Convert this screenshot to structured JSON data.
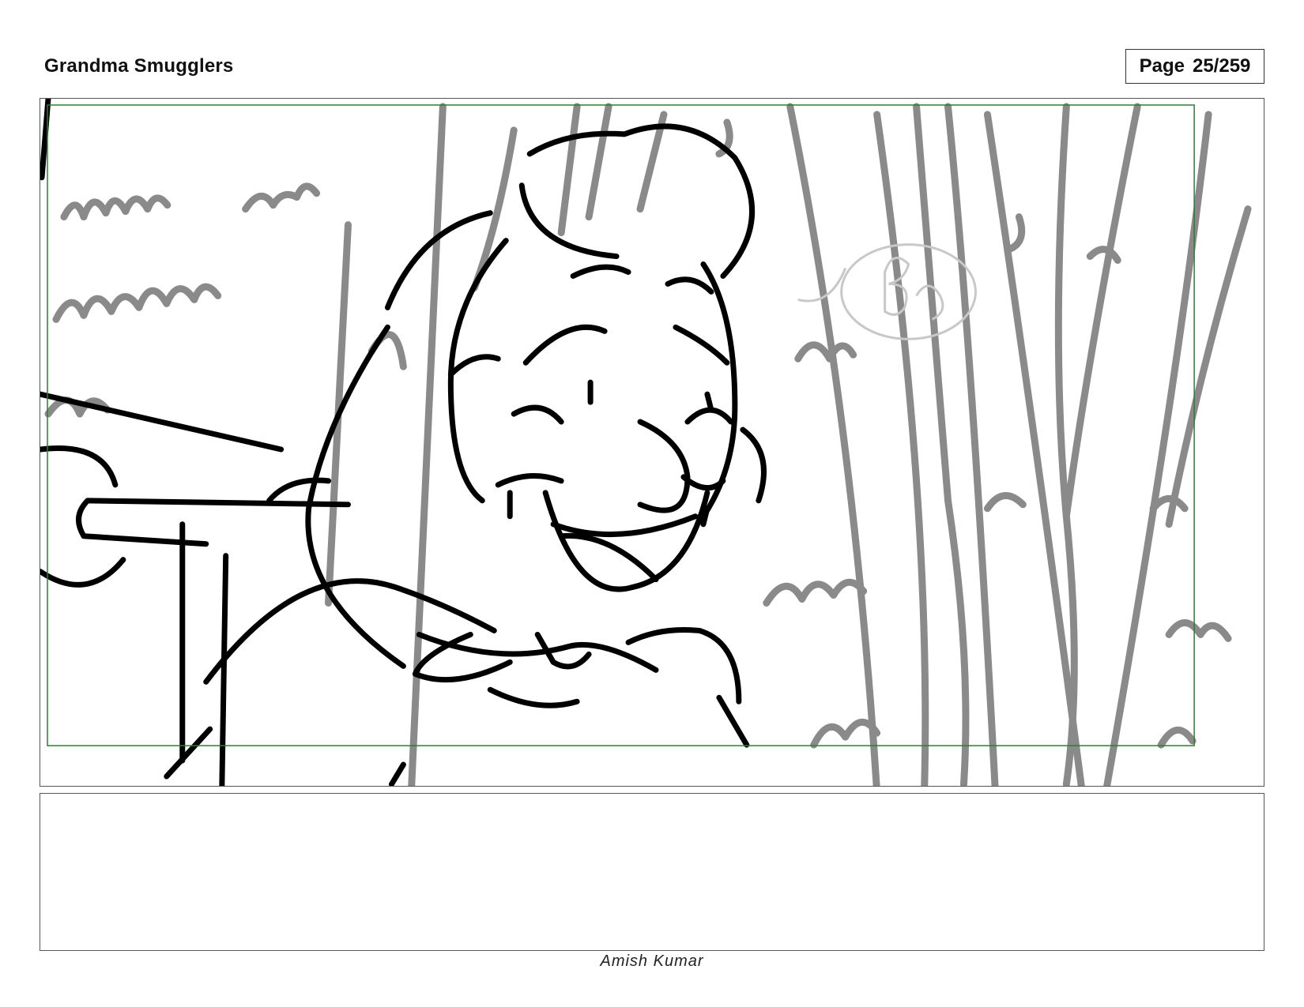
{
  "header": {
    "project_title": "Grandma Smugglers",
    "page_label": "Page",
    "page_number": "25/259"
  },
  "panel": {
    "safe_area_color": "#2e7d32",
    "background_line_color": "#8a8a8a",
    "foreground_line_color": "#000000",
    "watermark_color": "#c8c8c8"
  },
  "notes": {
    "text": ""
  },
  "footer": {
    "artist_name": "Amish Kumar"
  }
}
